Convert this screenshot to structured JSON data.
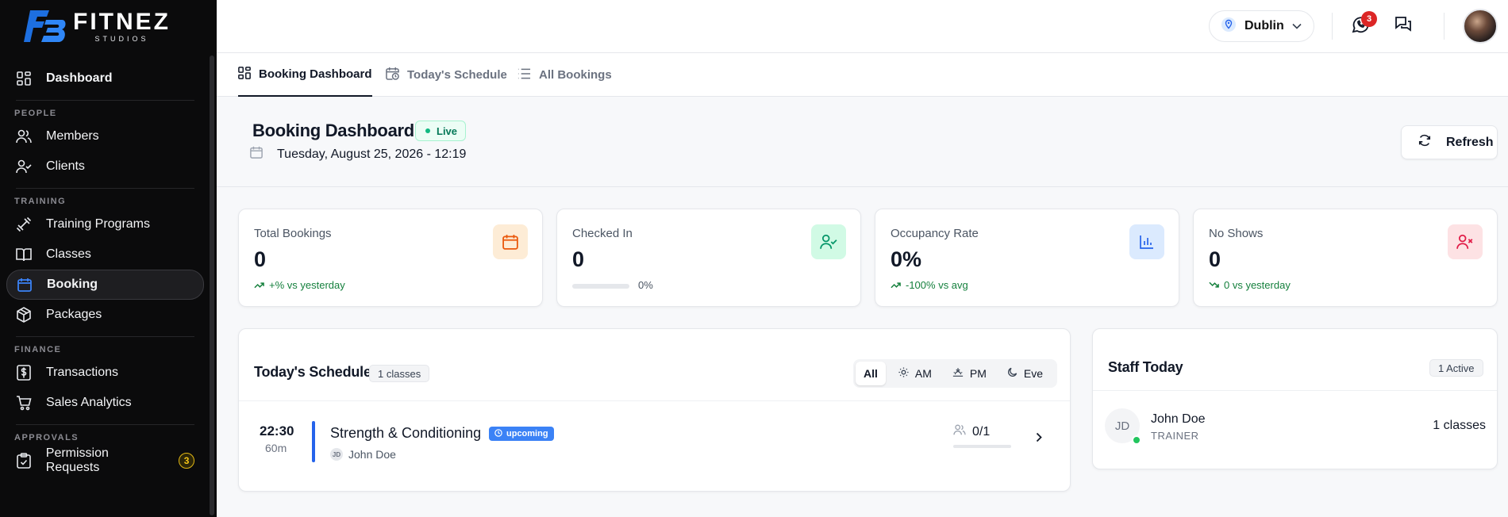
{
  "brand": {
    "name": "FITNEZ",
    "sub": "STUDIOS"
  },
  "sidebar": {
    "dashboard": "Dashboard",
    "sections": {
      "people": "PEOPLE",
      "training": "TRAINING",
      "finance": "FINANCE",
      "approvals": "APPROVALS"
    },
    "items": {
      "members": "Members",
      "clients": "Clients",
      "training_programs": "Training Programs",
      "classes": "Classes",
      "booking": "Booking",
      "packages": "Packages",
      "transactions": "Transactions",
      "sales_analytics": "Sales Analytics",
      "permission_requests": "Permission Requests"
    },
    "permission_badge": "3"
  },
  "topbar": {
    "location": "Dublin",
    "whatsapp_badge": "3"
  },
  "tabs": {
    "booking_dashboard": "Booking Dashboard",
    "todays_schedule": "Today's Schedule",
    "all_bookings": "All Bookings"
  },
  "header": {
    "title": "Booking Dashboard",
    "live": "Live",
    "date": "Tuesday, August 25, 2026 - 12:19",
    "refresh": "Refresh"
  },
  "stats": {
    "total_bookings": {
      "label": "Total Bookings",
      "value": "0",
      "sub": "+% vs yesterday"
    },
    "checked_in": {
      "label": "Checked In",
      "value": "0",
      "progress_label": "0%",
      "progress": 0
    },
    "occupancy": {
      "label": "Occupancy Rate",
      "value": "0%",
      "sub": "-100% vs avg"
    },
    "no_shows": {
      "label": "No Shows",
      "value": "0",
      "sub": "0 vs yesterday"
    }
  },
  "schedule": {
    "title": "Today's Schedule",
    "count": "1 classes",
    "filters": {
      "all": "All",
      "am": "AM",
      "pm": "PM",
      "eve": "Eve"
    },
    "class": {
      "time": "22:30",
      "duration": "60m",
      "name": "Strength & Conditioning",
      "status": "upcoming",
      "trainer_initials": "JD",
      "trainer": "John Doe",
      "capacity": "0/1"
    }
  },
  "staff": {
    "title": "Staff Today",
    "active": "1 Active",
    "member": {
      "initials": "JD",
      "name": "John Doe",
      "role": "TRAINER",
      "classes": "1 classes"
    }
  },
  "colors": {
    "accent_blue": "#2563eb",
    "success": "#15803d",
    "danger": "#dc2626",
    "warning": "#e2b714"
  }
}
